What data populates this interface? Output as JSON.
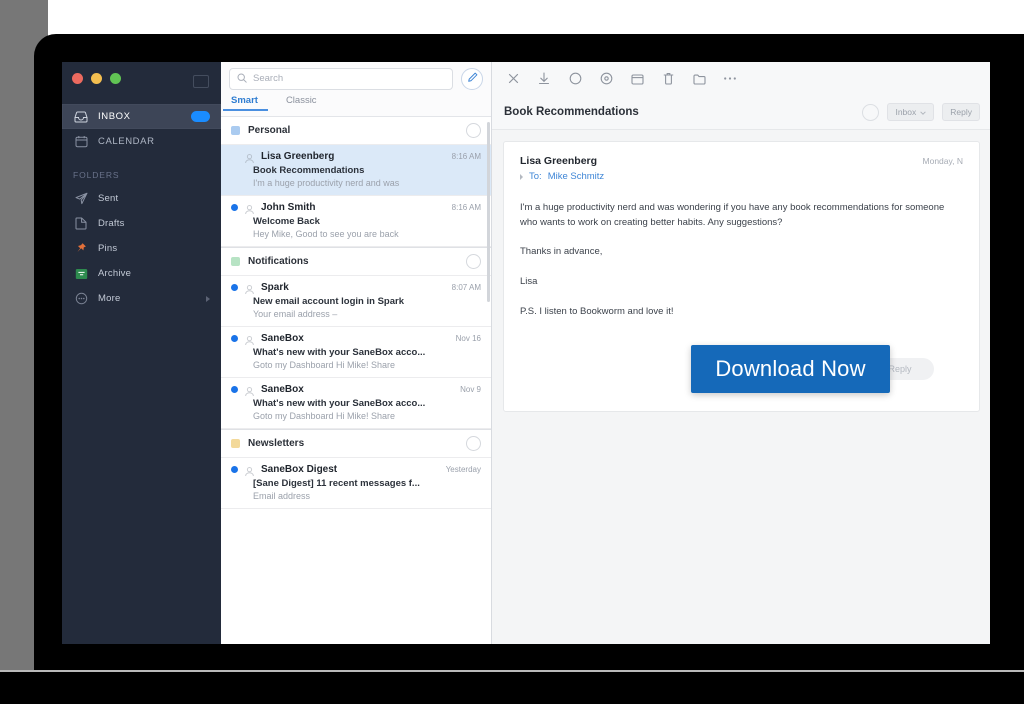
{
  "window": {
    "traffic_lights": [
      "close",
      "minimize",
      "zoom"
    ]
  },
  "sidebar": {
    "primary": [
      {
        "label": "INBOX",
        "icon": "inbox-icon",
        "active": true,
        "badge": true
      },
      {
        "label": "CALENDAR",
        "icon": "calendar-icon",
        "active": false,
        "badge": false
      }
    ],
    "folders_heading": "Folders",
    "folders": [
      {
        "label": "Sent",
        "icon": "sent-icon",
        "color": "#8b93a3"
      },
      {
        "label": "Drafts",
        "icon": "drafts-icon",
        "color": "#8b93a3"
      },
      {
        "label": "Pins",
        "icon": "pin-icon",
        "color": "#e2703a"
      },
      {
        "label": "Archive",
        "icon": "archive-icon",
        "color": "#2e8b4f"
      },
      {
        "label": "More",
        "icon": "more-icon",
        "color": "#8b93a3"
      }
    ]
  },
  "list": {
    "search": {
      "placeholder": "Search",
      "icon": "search-icon"
    },
    "compose": {
      "icon": "compose-pencil-icon"
    },
    "tabs": [
      {
        "label": "Smart",
        "active": true
      },
      {
        "label": "Classic",
        "active": false
      }
    ],
    "groups": [
      {
        "title": "Personal",
        "chip_color": "#aacbf0",
        "messages": [
          {
            "sender": "Lisa Greenberg",
            "time": "8:16 AM",
            "subject": "Book Recommendations",
            "snippet": "I'm a huge productivity nerd and was",
            "unread": false,
            "selected": true
          },
          {
            "sender": "John Smith",
            "time": "8:16 AM",
            "subject": "Welcome Back",
            "snippet": "Hey Mike, Good to see you are back",
            "unread": true,
            "selected": false
          }
        ]
      },
      {
        "title": "Notifications",
        "chip_color": "#b7e3c4",
        "messages": [
          {
            "sender": "Spark",
            "time": "8:07 AM",
            "subject": "New email account login in Spark",
            "snippet": "Your email address –",
            "unread": true,
            "selected": false
          },
          {
            "sender": "SaneBox",
            "time": "Nov 16",
            "subject": "What's new with your SaneBox acco...",
            "snippet": "Goto my Dashboard Hi Mike! Share",
            "unread": true,
            "selected": false
          },
          {
            "sender": "SaneBox",
            "time": "Nov 9",
            "subject": "What's new with your SaneBox acco...",
            "snippet": "Goto my Dashboard Hi Mike! Share",
            "unread": true,
            "selected": false
          }
        ]
      },
      {
        "title": "Newsletters",
        "chip_color": "#f3d99a",
        "messages": [
          {
            "sender": "SaneBox Digest",
            "time": "Yesterday",
            "subject": "[Sane Digest] 11 recent messages f...",
            "snippet": "Email address",
            "unread": true,
            "selected": false
          }
        ]
      }
    ]
  },
  "reading": {
    "toolbar": [
      {
        "name": "close-icon",
        "glyph": "×"
      },
      {
        "name": "archive-icon",
        "glyph": "⬇"
      },
      {
        "name": "snooze-icon",
        "glyph": "○"
      },
      {
        "name": "pin-icon",
        "glyph": "⊙"
      },
      {
        "name": "calendar-icon",
        "glyph": "Ὄ5"
      },
      {
        "name": "trash-icon",
        "glyph": "Ὕ1"
      },
      {
        "name": "move-folder-icon",
        "glyph": "὜0"
      },
      {
        "name": "more-actions-icon",
        "glyph": "⋯"
      }
    ],
    "title": "Book Recommendations",
    "header_pill": "Inbox",
    "message": {
      "from": "Lisa Greenberg",
      "date": "Monday, N",
      "to_label": "To:",
      "to": "Mike Schmitz",
      "paragraphs": [
        "I'm a huge productivity nerd and was wondering if you have any book recommendations for someone who wants to work on creating better habits. Any suggestions?",
        "Thanks in advance,",
        "Lisa",
        "P.S. I listen to Bookworm and love it!"
      ]
    },
    "reply_label": "Reply"
  },
  "overlay": {
    "cta_label": "Download Now",
    "cta_color": "#1569b9"
  }
}
